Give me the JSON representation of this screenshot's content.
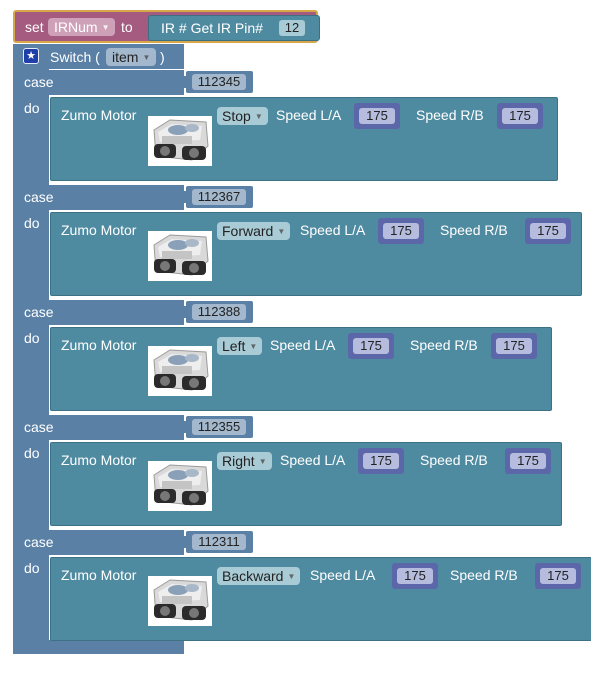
{
  "set_block": {
    "set_label": "set",
    "variable": "IRNum",
    "to_label": "to",
    "ir_get_label": "IR # Get  IR Pin#",
    "ir_pin": "12"
  },
  "switch_block": {
    "label": "Switch (",
    "variable": "item",
    "close_paren": ")",
    "case_label": "case",
    "do_label": "do"
  },
  "cases": [
    {
      "value": "112345",
      "motor_label": "Zumo Motor",
      "direction": "Stop",
      "speed_left_label": "Speed L/A",
      "speed_left": "175",
      "speed_right_label": "Speed R/B",
      "speed_right": "175"
    },
    {
      "value": "112367",
      "motor_label": "Zumo Motor",
      "direction": "Forward",
      "speed_left_label": "Speed L/A",
      "speed_left": "175",
      "speed_right_label": "Speed R/B",
      "speed_right": "175"
    },
    {
      "value": "112388",
      "motor_label": "Zumo Motor",
      "direction": "Left",
      "speed_left_label": "Speed L/A",
      "speed_left": "175",
      "speed_right_label": "Speed R/B",
      "speed_right": "175"
    },
    {
      "value": "112355",
      "motor_label": "Zumo Motor",
      "direction": "Right",
      "speed_left_label": "Speed L/A",
      "speed_left": "175",
      "speed_right_label": "Speed R/B",
      "speed_right": "175"
    },
    {
      "value": "112311",
      "motor_label": "Zumo Motor",
      "direction": "Backward",
      "speed_left_label": "Speed L/A",
      "speed_left": "175",
      "speed_right_label": "Speed R/B",
      "speed_right": "175"
    }
  ],
  "colors": {
    "set_block": "#a55b80",
    "switch_block": "#5a80a6",
    "motor_block": "#4f8ba0",
    "number_block": "#5b67a8"
  },
  "icons": [
    "star-icon",
    "zumo-robot-image",
    "dropdown-caret-icon"
  ]
}
